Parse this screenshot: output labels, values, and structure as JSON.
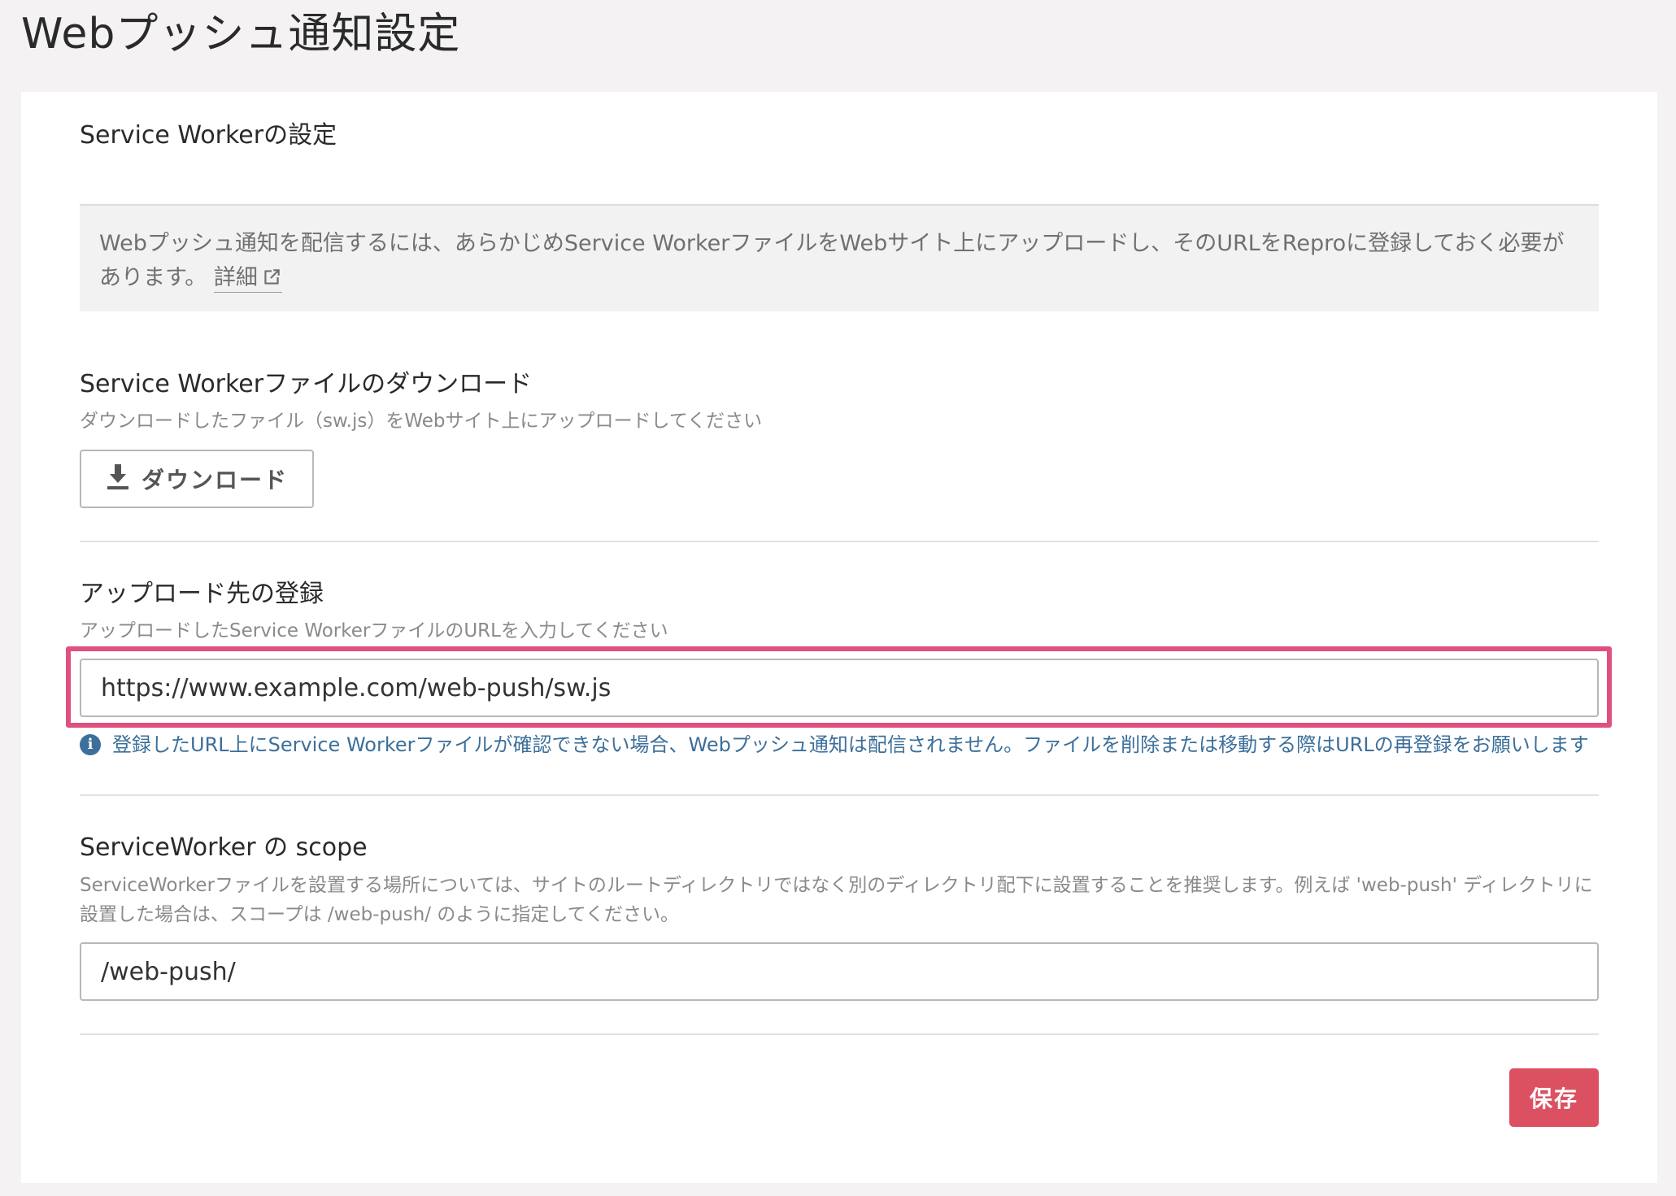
{
  "page_title": "Webプッシュ通知設定",
  "service_worker_settings": {
    "heading": "Service Workerの設定",
    "notice_text": "Webプッシュ通知を配信するには、あらかじめService WorkerファイルをWebサイト上にアップロードし、そのURLをReproに登録しておく必要があります。",
    "detail_link_label": "詳細"
  },
  "download_section": {
    "heading": "Service Workerファイルのダウンロード",
    "hint": "ダウンロードしたファイル（sw.js）をWebサイト上にアップロードしてください",
    "button_label": "ダウンロード"
  },
  "upload_section": {
    "heading": "アップロード先の登録",
    "hint": "アップロードしたService WorkerファイルのURLを入力してください",
    "url_value": "https://www.example.com/web-push/sw.js",
    "info_text": "登録したURL上にService Workerファイルが確認できない場合、Webプッシュ通知は配信されません。ファイルを削除または移動する際はURLの再登録をお願いします"
  },
  "scope_section": {
    "heading": "ServiceWorker の scope",
    "description": "ServiceWorkerファイルを設置する場所については、サイトのルートディレクトリではなく別のディレクトリ配下に設置することを推奨します。例えば 'web-push' ディレクトリに設置した場合は、スコープは /web-push/ のように指定してください。",
    "scope_value": "/web-push/"
  },
  "save_label": "保存",
  "colors": {
    "accent_highlight": "#e0507f",
    "save_button": "#dc5162",
    "info_text": "#3c6f9a",
    "page_background": "#f4f2f3"
  },
  "icons": {
    "download": "download-icon",
    "external_link": "external-link-icon",
    "info": "info-icon"
  }
}
